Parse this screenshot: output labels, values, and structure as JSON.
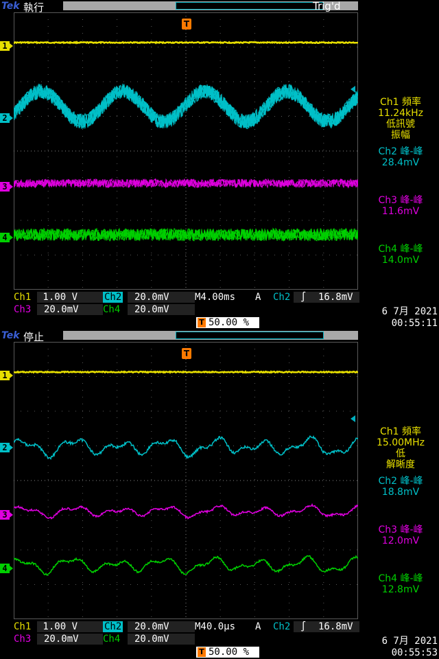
{
  "screens": [
    {
      "logo": "Tek",
      "state": "執行",
      "trig_state": "Trig'd",
      "trigger_marker": "T",
      "channel_markers": [
        "1",
        "2",
        "3",
        "4"
      ],
      "measurements": {
        "ch1_label": "Ch1 頻率",
        "ch1_value": "11.24kHz",
        "ch1_note1": "低訊號",
        "ch1_note2": "振幅",
        "ch2_label": "Ch2 峰-峰",
        "ch2_value": "28.4mV",
        "ch3_label": "Ch3 峰-峰",
        "ch3_value": "11.6mV",
        "ch4_label": "Ch4 峰-峰",
        "ch4_value": "14.0mV"
      },
      "readout": {
        "ch1": "Ch1",
        "ch1_scale": " 1.00 V",
        "ch2": "Ch2",
        "ch2_scale": "20.0mV",
        "ch3": "Ch3",
        "ch3_scale": "20.0mV",
        "ch4": "Ch4",
        "ch4_scale": "20.0mV",
        "timebase": "M4.00ms",
        "trig_mode": "A",
        "trig_source": "Ch2",
        "trig_slope": "∫",
        "trig_level": "16.8mV",
        "trig_position": "50.00 %",
        "date": "6 7月  2021",
        "time": "00:55:11"
      },
      "waveform_style": "sine"
    },
    {
      "logo": "Tek",
      "state": "停止",
      "trig_state": "",
      "trigger_marker": "T",
      "channel_markers": [
        "1",
        "2",
        "3",
        "4"
      ],
      "measurements": {
        "ch1_label": "Ch1 頻率",
        "ch1_value": "15.00MHz",
        "ch1_note1": "低",
        "ch1_note2": "解晰度",
        "ch2_label": "Ch2 峰-峰",
        "ch2_value": "18.8mV",
        "ch3_label": "Ch3 峰-峰",
        "ch3_value": "12.0mV",
        "ch4_label": "Ch4 峰-峰",
        "ch4_value": "12.8mV"
      },
      "readout": {
        "ch1": "Ch1",
        "ch1_scale": " 1.00 V",
        "ch2": "Ch2",
        "ch2_scale": "20.0mV",
        "ch3": "Ch3",
        "ch3_scale": "20.0mV",
        "ch4": "Ch4",
        "ch4_scale": "20.0mV",
        "timebase": "M40.0µs",
        "trig_mode": "A",
        "trig_source": "Ch2",
        "trig_slope": "∫",
        "trig_level": "16.8mV",
        "trig_position": "50.00 %",
        "date": "6 7月  2021",
        "time": "00:55:53"
      },
      "waveform_style": "noisy"
    }
  ],
  "colors": {
    "ch1": "#e8e000",
    "ch2": "#00c0c8",
    "ch3": "#e000e0",
    "ch4": "#00d000",
    "grid": "#5a5a5a",
    "trigger": "#ff7a00"
  }
}
